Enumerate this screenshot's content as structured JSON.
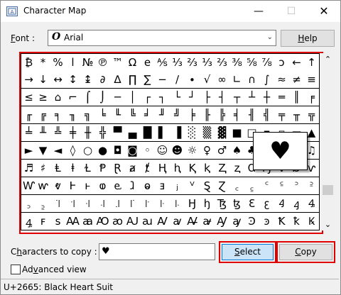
{
  "window": {
    "title": "Character Map"
  },
  "titlebar": {
    "minimize": "—",
    "maximize": "☐",
    "close": "✕"
  },
  "font": {
    "label": "Font :",
    "value": "Arial",
    "type_icon": "O"
  },
  "buttons": {
    "help": "Help",
    "select": "Select",
    "copy": "Copy"
  },
  "grid": {
    "rows": [
      [
        "₿",
        "*",
        "%",
        "l",
        "№",
        "℗",
        "™",
        "Ω",
        "e",
        "⅍",
        "⅓",
        "⅔",
        "⅓",
        "⅔",
        "⅜",
        "⅝",
        "⅞",
        "ↄ",
        "←",
        "↑"
      ],
      [
        "→",
        "↓",
        "↔",
        "↕",
        "↨",
        "∂",
        "∆",
        "∏",
        "∑",
        "−",
        "∕",
        "∙",
        "√",
        "∞",
        "∟",
        "∩",
        "∫",
        "≈",
        "≠",
        "≡"
      ],
      [
        "≤",
        "≥",
        "⌂",
        "⌐",
        "⌠",
        "⌡",
        "─",
        "│",
        "┌",
        "┐",
        "└",
        "┘",
        "├",
        "┤",
        "┬",
        "┴",
        "┼",
        "═",
        "║",
        "╒"
      ],
      [
        "╓",
        "╔",
        "╕",
        "╖",
        "╗",
        "╘",
        "╙",
        "╚",
        "╛",
        "╜",
        "╝",
        "╞",
        "╟",
        "╠",
        "╡",
        "╢",
        "╣",
        "╤",
        "╥",
        "╦"
      ],
      [
        "╧",
        "╨",
        "╩",
        "╪",
        "╫",
        "╬",
        "▀",
        "▄",
        "█",
        "▌",
        "▐",
        "░",
        "▒",
        "▓",
        "■",
        "□",
        "▪",
        "▫",
        "▬",
        "▲"
      ],
      [
        "►",
        "▼",
        "◄",
        "◊",
        "○",
        "●",
        "◘",
        "◙",
        "◦",
        "☺",
        "☻",
        "☼",
        "♀",
        "♂",
        "♠",
        "♣",
        "♥",
        "♦",
        "♪",
        "♫"
      ],
      [
        "♬",
        "♯",
        "Ⱡ",
        "ⱡ",
        "Ɫ",
        "Ᵽ",
        "Ɽ",
        "ⱥ",
        "ⱦ",
        "Ⱨ",
        "ⱨ",
        "Ⱪ",
        "ⱪ",
        "Ⱬ",
        "ⱬ",
        "Ɑ",
        "Ɱ",
        "Ɐ",
        "Ɒ",
        "ⱱ"
      ],
      [
        "Ⱳ",
        "ⱳ",
        "ⱴ",
        "Ⱶ",
        "ⱶ",
        "ⱷ",
        "ⱸ",
        "ⱹ",
        "ⱺ",
        "ⱻ",
        "ⱼ",
        "ⱽ",
        "Ȿ",
        "Ɀ",
        "꜀",
        "꜁",
        "꜂",
        "꜃",
        "꜄",
        "꜅"
      ],
      [
        "꜆",
        "꜇",
        "꜈",
        "꜉",
        "꜊",
        "꜋",
        "꜌",
        "꜍",
        "꜎",
        "꜏",
        "꜐",
        "Ꜧ",
        "ꜧ",
        "Ꜩ",
        "ꜩ",
        "Ꜫ",
        "ꜫ",
        "Ꜭ",
        "ꜭ",
        "Ꜯ"
      ],
      [
        "ꜯ",
        "ꜰ",
        "ꜱ",
        "Ꜳ",
        "ꜳ",
        "Ꜵ",
        "ꜵ",
        "Ꜷ",
        "ꜷ",
        "Ꜹ",
        "ꜹ",
        "Ꜻ",
        "ꜻ",
        "Ꜽ",
        "ꜽ",
        "Ꜿ",
        "ꜿ",
        "Ꝁ",
        "ꝁ",
        "Ꝃ"
      ]
    ]
  },
  "magnifier": {
    "char": "♥"
  },
  "copy": {
    "label": "Characters to copy :",
    "value": "♥"
  },
  "advanced": {
    "label": "Advanced view",
    "checked": false
  },
  "status": {
    "text": "U+2665: Black Heart Suit"
  },
  "colors": {
    "highlight": "#e00000",
    "select_button_bg": "#cce4f7",
    "select_button_border": "#0078d7"
  }
}
